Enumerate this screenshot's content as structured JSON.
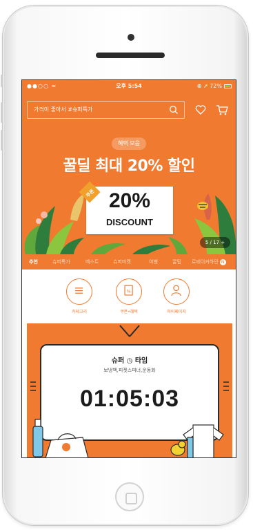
{
  "status_bar": {
    "signal": "●●○○ ≈",
    "time": "오후 5:54",
    "right": "⊕ ➚ 72%"
  },
  "search": {
    "placeholder": "가격이 좋아서 #슈퍼특가"
  },
  "banner": {
    "pill": "혜택 모음",
    "title": "꿀딜 최대 20% 할인",
    "coupon_tag": "쿠폰",
    "coupon_value": "20%",
    "coupon_text": "DISCOUNT",
    "slide_counter": "5 / 17 +"
  },
  "tabs": [
    {
      "label": "추천",
      "active": true
    },
    {
      "label": "슈퍼특가"
    },
    {
      "label": "베스트"
    },
    {
      "label": "슈퍼마켓"
    },
    {
      "label": "여행"
    },
    {
      "label": "꿀팁"
    },
    {
      "label": "로테이커하민"
    }
  ],
  "quick_menu": [
    {
      "label": "카테고리",
      "icon": "menu-icon"
    },
    {
      "label": "쿠폰•혜택",
      "icon": "coupon-icon"
    },
    {
      "label": "마이페이지",
      "icon": "person-icon"
    }
  ],
  "super_time": {
    "title": "슈퍼 ◷ 타임",
    "subtitle": "보냉백,피젯스피너,운동화",
    "timer": "01:05:03"
  },
  "colors": {
    "accent": "#ef7a30",
    "pill": "#f59b62",
    "leaf_dark": "#2f7d3c",
    "leaf_light": "#8cc63f"
  }
}
